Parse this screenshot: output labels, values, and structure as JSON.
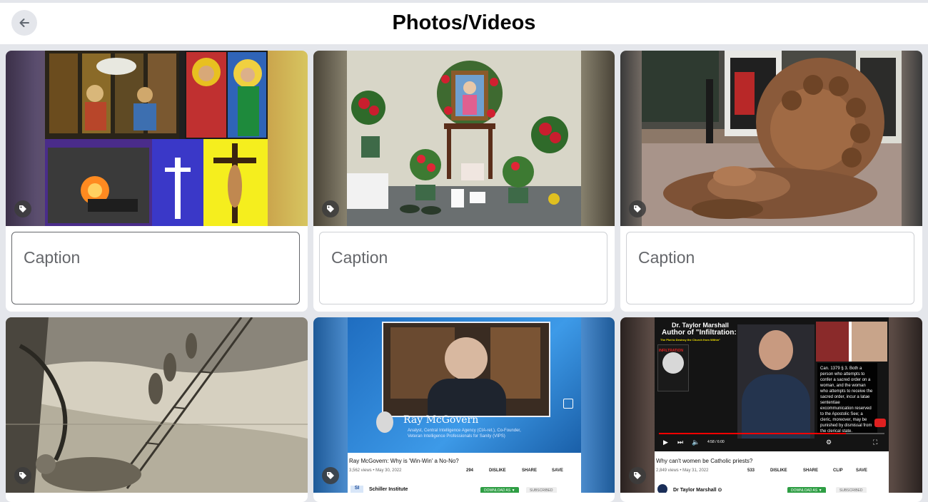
{
  "header": {
    "title": "Photos/Videos",
    "back_icon": "arrow-left-icon"
  },
  "caption_placeholder": "Caption",
  "cards": [
    {
      "kind": "stained-glass collage"
    },
    {
      "kind": "marian shrine altar"
    },
    {
      "kind": "bronze lion sculpture"
    },
    {
      "kind": "engraving jacobs ladder"
    },
    {
      "kind": "youtube screenshot",
      "name_overlay": "Ray McGovern",
      "sub_overlay_1": "Analyst, Central Intelligence Agency (CIA-ret.), Co-Founder,",
      "sub_overlay_2": "Veteran Intelligence Professionals for Sanity (VIPS)",
      "video_title": "Ray McGovern: Why is 'Win-Win' a No-No?",
      "meta": "3,562 views • May 30, 2022",
      "likes": "294",
      "dislike": "DISLIKE",
      "share": "SHARE",
      "save": "SAVE",
      "channel": "Schiller Institute",
      "channel_avatar": "SI",
      "download": "DOWNLOAD AS ▼",
      "subscribed": "SUBSCRIBED"
    },
    {
      "kind": "youtube screenshot",
      "overlay_line_1": "Dr. Taylor Marshall",
      "overlay_line_2": "Author of \"Infiltration:",
      "overlay_line_3": "The Plot to Destroy the Church from Within\"",
      "book_title": "INFILTRATION",
      "canon_text": "Can. 1379 § 3. Both a person who attempts to confer a sacred order on a woman, and the woman who attempts to receive the sacred order, incur a latae sententiae excommunication reserved to the Apostolic See; a cleric, moreover, may be punished by dismissal from the clerical state.",
      "time": "4:58 / 6:00",
      "video_title": "Why can't women be Catholic priests?",
      "meta": "2,849 views • May 31, 2022",
      "likes": "533",
      "dislike": "DISLIKE",
      "share": "SHARE",
      "clip": "CLIP",
      "save": "SAVE",
      "channel": "Dr Taylor Marshall ⊙",
      "download": "DOWNLOAD AS ▼",
      "subscribed": "SUBSCRIBED"
    }
  ],
  "colors": {
    "background": "#e4e6eb",
    "card": "#ffffff",
    "placeholder": "#65676b",
    "youtube_red": "#ff0000"
  }
}
